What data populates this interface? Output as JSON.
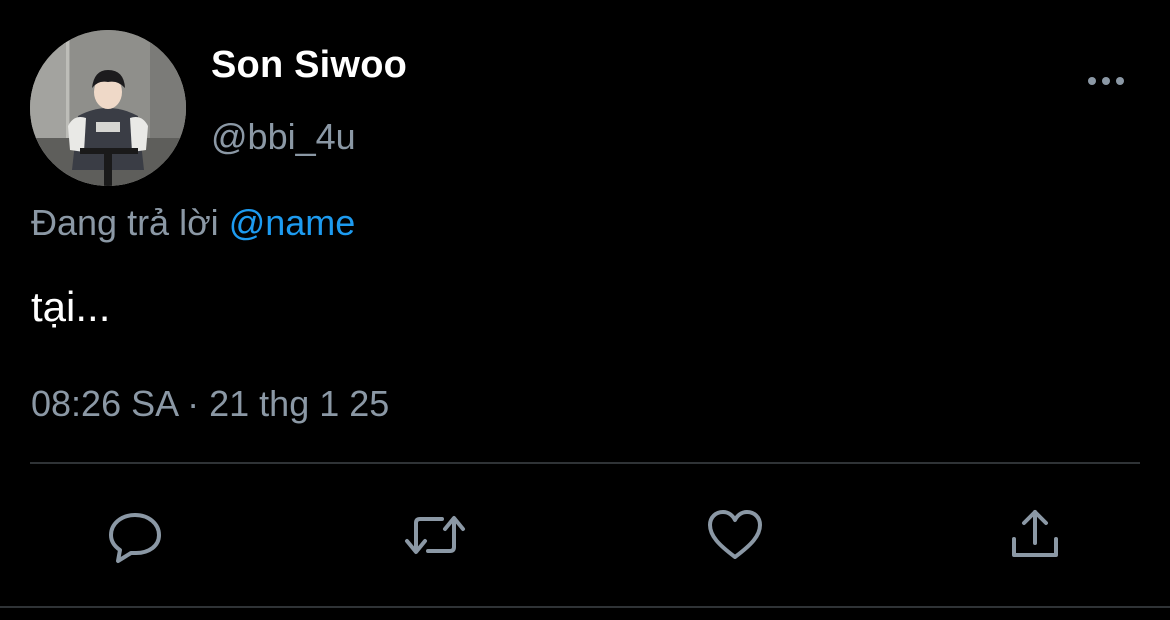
{
  "tweet": {
    "author": {
      "display_name": "Son Siwoo",
      "handle": "@bbi_4u"
    },
    "reply_prefix": "Đang trả lời",
    "reply_mention": "@name",
    "text": "tại...",
    "timestamp": "08:26 SA · 21 thg 1 25"
  },
  "actions": {
    "icons": [
      "reply-icon",
      "retweet-icon",
      "like-icon",
      "share-icon"
    ]
  },
  "colors": {
    "background": "#000000",
    "primary_text": "#ffffff",
    "secondary_text": "#8b98a5",
    "link": "#1d9bf0",
    "divider": "#2f3336"
  }
}
